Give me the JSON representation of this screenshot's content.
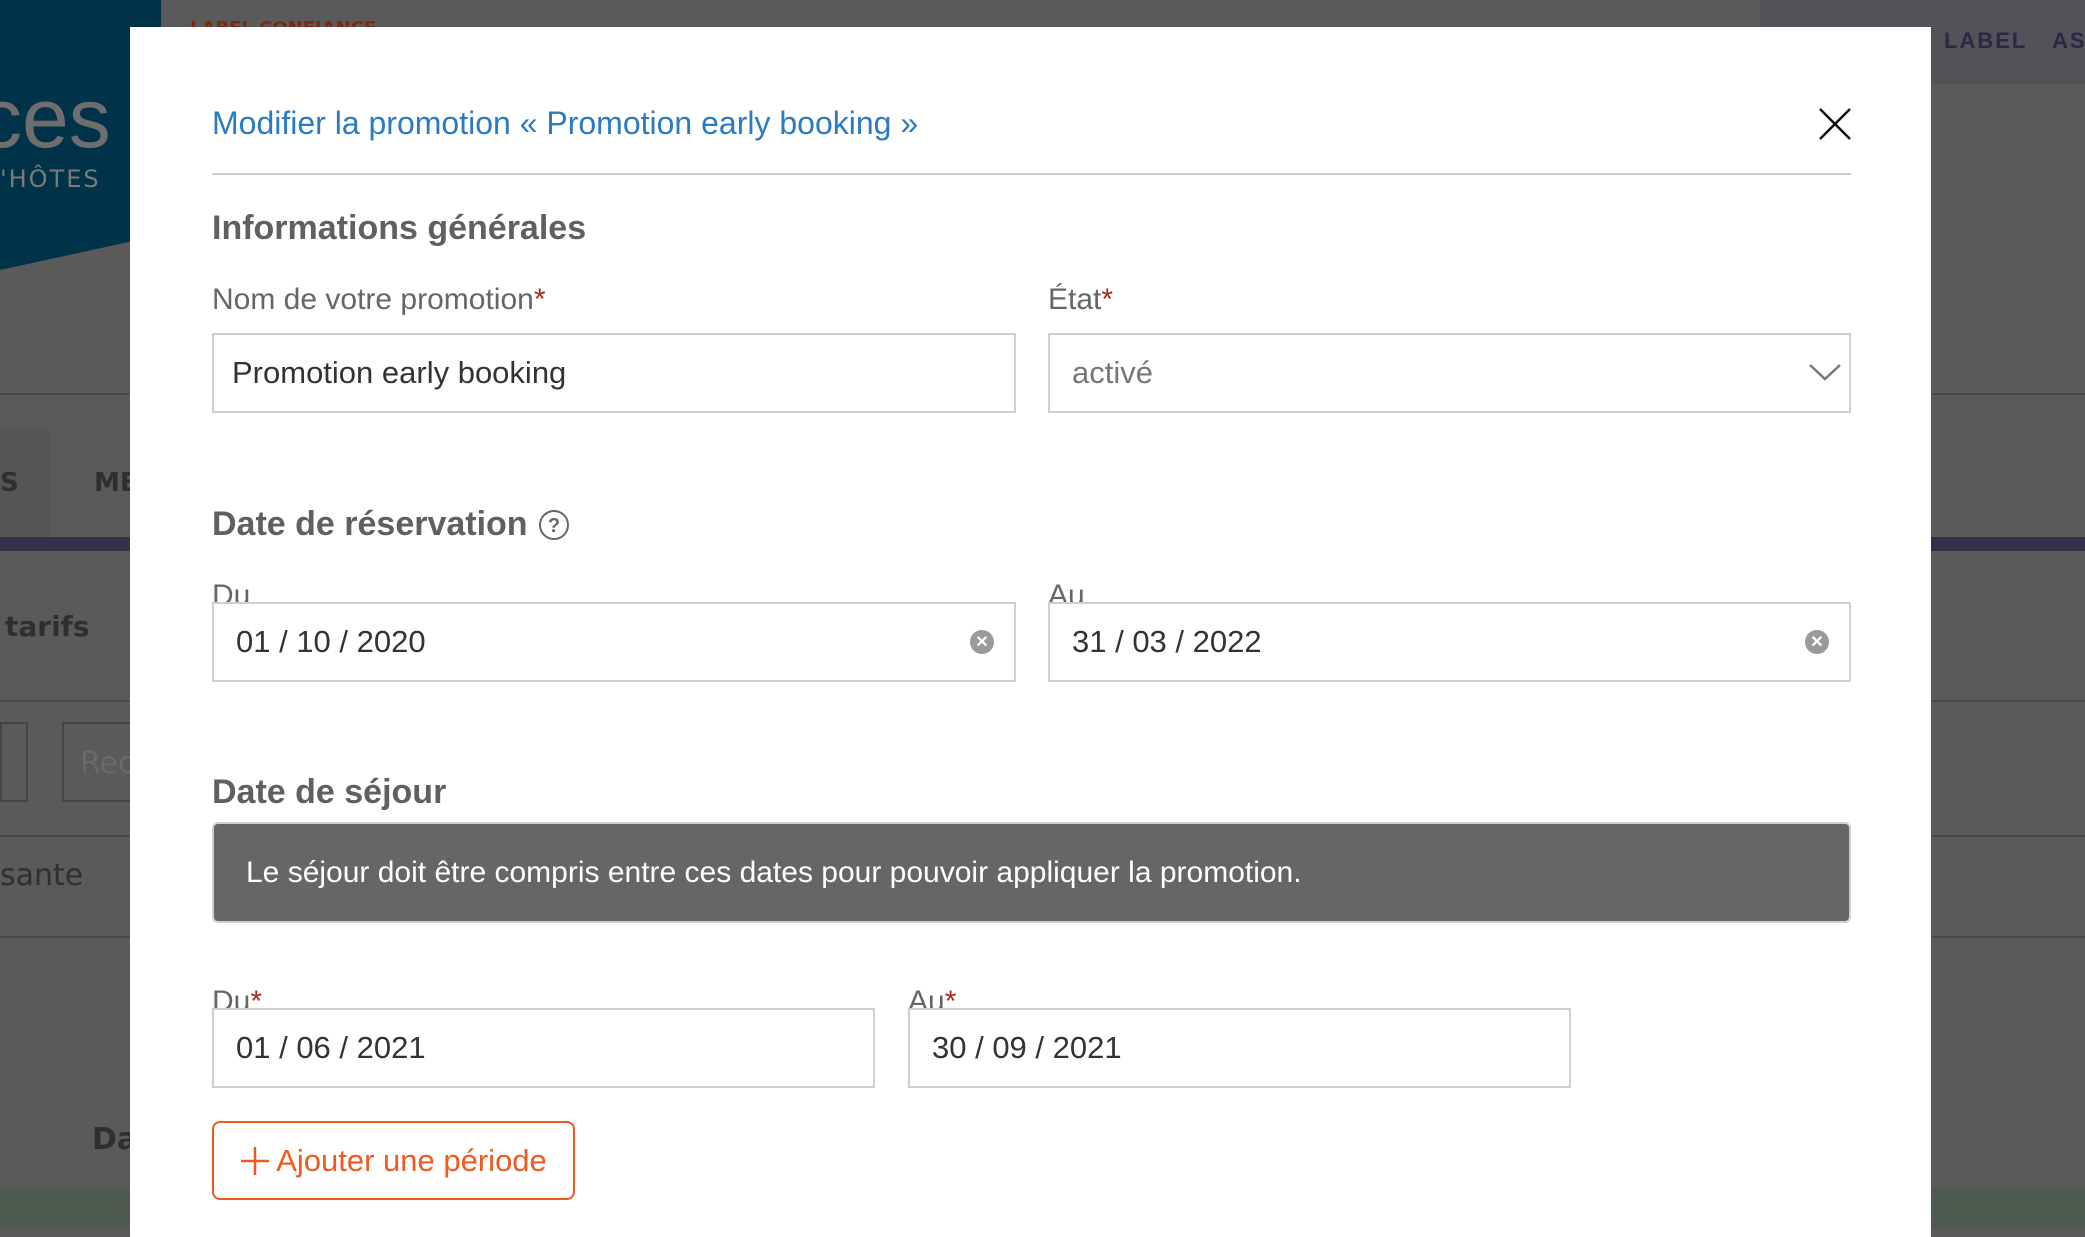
{
  "background": {
    "logo_text": "ces",
    "logo_sub": "'HÔTES",
    "top_link": "LABEL CONFIANCE",
    "top_right": [
      "LABEL",
      "ASS"
    ],
    "nav_items": [
      "S",
      "MES"
    ],
    "left_texts": [
      "tarifs",
      "Rec",
      "sante",
      "Da"
    ]
  },
  "modal": {
    "title": "Modifier la promotion « Promotion early booking »",
    "colors": {
      "title": "#2b7bc0",
      "accent": "#f05a1e",
      "required": "#b3261e"
    },
    "general": {
      "heading": "Informations générales",
      "name_label": "Nom de votre promotion",
      "name_value": "Promotion early booking",
      "state_label": "État",
      "state_value": "activé"
    },
    "booking": {
      "heading": "Date de réservation",
      "from_label": "Du",
      "from_value": "01 / 10 / 2020",
      "to_label": "Au",
      "to_value": "31 / 03 / 2022"
    },
    "stay": {
      "heading": "Date de séjour",
      "info": "Le séjour doit être compris entre ces dates pour pouvoir appliquer la promotion.",
      "from_label": "Du",
      "from_value": "01 / 06 / 2021",
      "to_label": "Au",
      "to_value": "30 / 09 / 2021",
      "add_button": "Ajouter une période"
    },
    "required_mark": "*"
  }
}
